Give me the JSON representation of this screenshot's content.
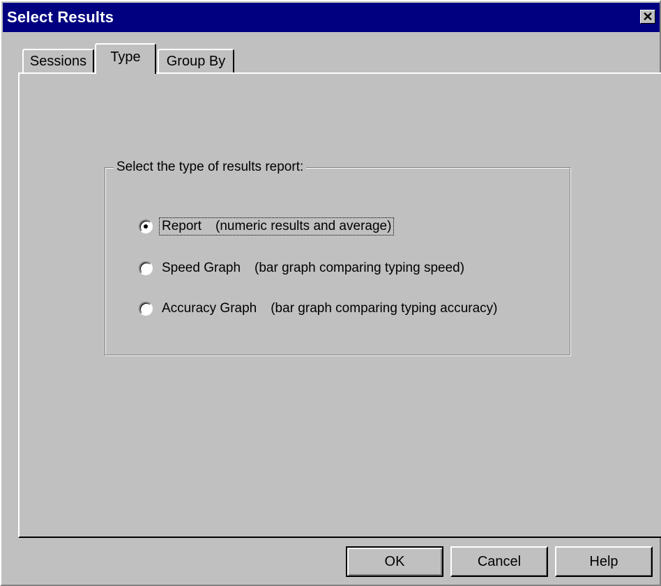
{
  "window": {
    "title": "Select Results",
    "close_glyph": "✕"
  },
  "tabs": [
    {
      "label": "Sessions",
      "selected": false
    },
    {
      "label": "Type",
      "selected": true
    },
    {
      "label": "Group By",
      "selected": false
    }
  ],
  "groupbox": {
    "legend": "Select the type of results report:"
  },
  "options": [
    {
      "label": "Report",
      "description": "(numeric results and average)",
      "selected": true
    },
    {
      "label": "Speed Graph",
      "description": "(bar graph comparing typing speed)",
      "selected": false
    },
    {
      "label": "Accuracy Graph",
      "description": "(bar graph comparing typing accuracy)",
      "selected": false
    }
  ],
  "buttons": {
    "ok": "OK",
    "cancel": "Cancel",
    "help": "Help"
  },
  "colors": {
    "face": "#c0c0c0",
    "titlebar": "#000080",
    "highlight": "#ffffff",
    "shadow": "#808080"
  }
}
